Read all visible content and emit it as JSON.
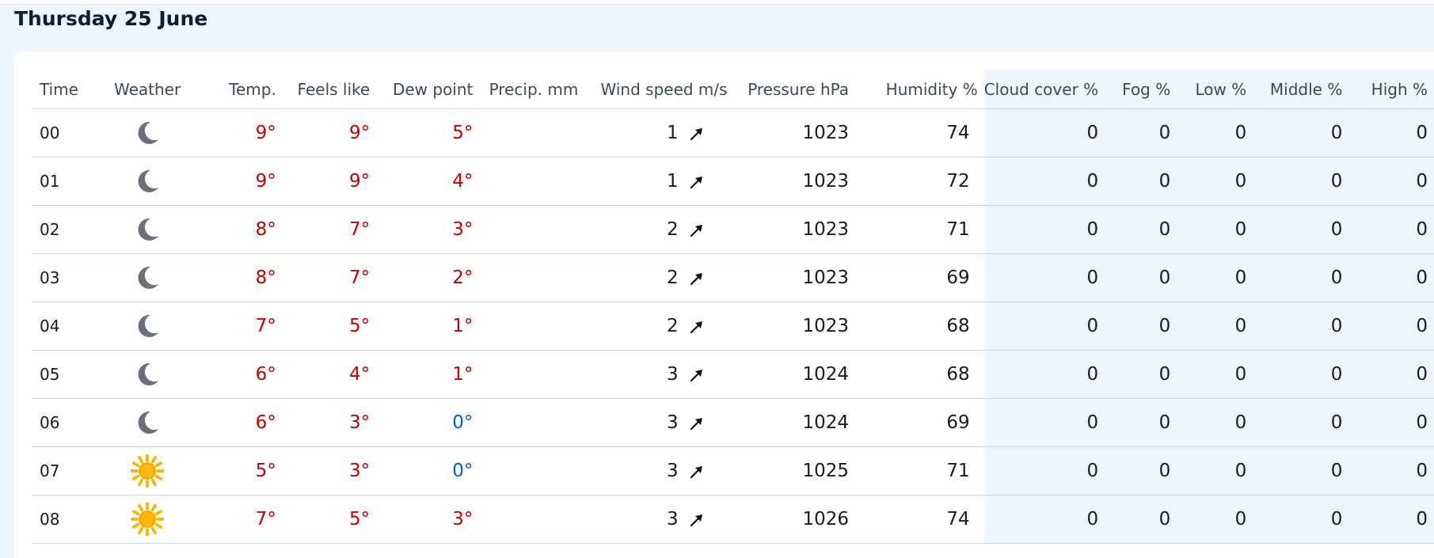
{
  "day": {
    "title": "Thursday 25 June"
  },
  "columns": {
    "time": "Time",
    "weather": "Weather",
    "temp": "Temp.",
    "feels": "Feels like",
    "dew": "Dew point",
    "precip": "Precip. mm",
    "wind": "Wind speed m/s",
    "pressure": "Pressure hPa",
    "humidity": "Humidity %",
    "cloud": "Cloud cover %",
    "fog": "Fog %",
    "low": "Low %",
    "middle": "Middle %",
    "high": "High %"
  },
  "colors": {
    "warm": "#c60000",
    "cold": "#0060c8",
    "header_bg": "#edf5fe"
  },
  "rows": [
    {
      "time": "00",
      "icon": "moon-icon",
      "temp": "9°",
      "feels": "9°",
      "dew": "5°",
      "dew_class": "warm",
      "precip": "",
      "wind": "1",
      "wind_dir": "north-east",
      "pressure": "1023",
      "humidity": "74",
      "cloud": "0",
      "fog": "0",
      "low": "0",
      "middle": "0",
      "high": "0"
    },
    {
      "time": "01",
      "icon": "moon-icon",
      "temp": "9°",
      "feels": "9°",
      "dew": "4°",
      "dew_class": "warm",
      "precip": "",
      "wind": "1",
      "wind_dir": "north-east",
      "pressure": "1023",
      "humidity": "72",
      "cloud": "0",
      "fog": "0",
      "low": "0",
      "middle": "0",
      "high": "0"
    },
    {
      "time": "02",
      "icon": "moon-icon",
      "temp": "8°",
      "feels": "7°",
      "dew": "3°",
      "dew_class": "warm",
      "precip": "",
      "wind": "2",
      "wind_dir": "north-east",
      "pressure": "1023",
      "humidity": "71",
      "cloud": "0",
      "fog": "0",
      "low": "0",
      "middle": "0",
      "high": "0"
    },
    {
      "time": "03",
      "icon": "moon-icon",
      "temp": "8°",
      "feels": "7°",
      "dew": "2°",
      "dew_class": "warm",
      "precip": "",
      "wind": "2",
      "wind_dir": "north-east",
      "pressure": "1023",
      "humidity": "69",
      "cloud": "0",
      "fog": "0",
      "low": "0",
      "middle": "0",
      "high": "0"
    },
    {
      "time": "04",
      "icon": "moon-icon",
      "temp": "7°",
      "feels": "5°",
      "dew": "1°",
      "dew_class": "warm",
      "precip": "",
      "wind": "2",
      "wind_dir": "north-east",
      "pressure": "1023",
      "humidity": "68",
      "cloud": "0",
      "fog": "0",
      "low": "0",
      "middle": "0",
      "high": "0"
    },
    {
      "time": "05",
      "icon": "moon-icon",
      "temp": "6°",
      "feels": "4°",
      "dew": "1°",
      "dew_class": "warm",
      "precip": "",
      "wind": "3",
      "wind_dir": "north-east",
      "pressure": "1024",
      "humidity": "68",
      "cloud": "0",
      "fog": "0",
      "low": "0",
      "middle": "0",
      "high": "0"
    },
    {
      "time": "06",
      "icon": "moon-icon",
      "temp": "6°",
      "feels": "3°",
      "dew": "0°",
      "dew_class": "cold",
      "precip": "",
      "wind": "3",
      "wind_dir": "north-east",
      "pressure": "1024",
      "humidity": "69",
      "cloud": "0",
      "fog": "0",
      "low": "0",
      "middle": "0",
      "high": "0"
    },
    {
      "time": "07",
      "icon": "sun-icon",
      "temp": "5°",
      "feels": "3°",
      "dew": "0°",
      "dew_class": "cold",
      "precip": "",
      "wind": "3",
      "wind_dir": "north-east",
      "pressure": "1025",
      "humidity": "71",
      "cloud": "0",
      "fog": "0",
      "low": "0",
      "middle": "0",
      "high": "0"
    },
    {
      "time": "08",
      "icon": "sun-icon",
      "temp": "7°",
      "feels": "5°",
      "dew": "3°",
      "dew_class": "warm",
      "precip": "",
      "wind": "3",
      "wind_dir": "north-east",
      "pressure": "1026",
      "humidity": "74",
      "cloud": "0",
      "fog": "0",
      "low": "0",
      "middle": "0",
      "high": "0"
    }
  ]
}
